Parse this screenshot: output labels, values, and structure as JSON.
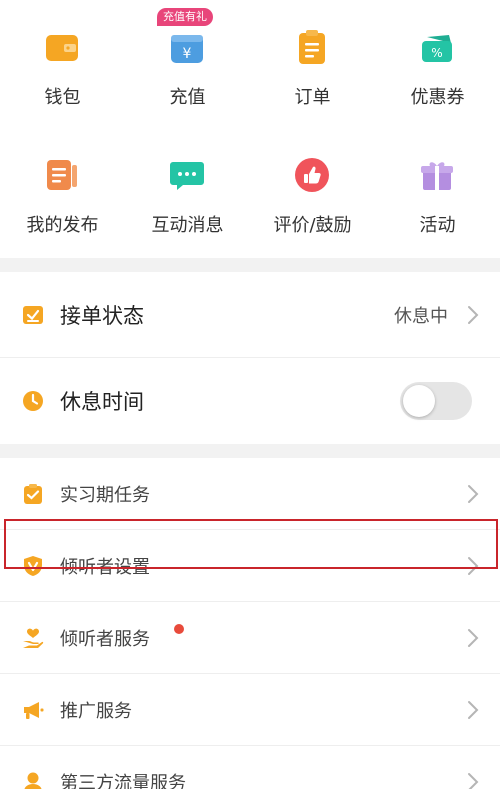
{
  "colors": {
    "wallet": "#f5a623",
    "recharge": "#4d9de0",
    "orders": "#f5a623",
    "coupons": "#24c4a5",
    "publish": "#f08a4b",
    "messages": "#24c4a5",
    "reviews": "#f0545b",
    "activity": "#b48ee0",
    "accent_orange": "#f5a623",
    "badge_pink": "#e8457a",
    "highlight_red": "#c9252b",
    "dot_red": "#e84a3b"
  },
  "grid": {
    "row1": [
      {
        "label": "钱包",
        "icon": "wallet-icon"
      },
      {
        "label": "充值",
        "icon": "recharge-icon",
        "badge": "充值有礼"
      },
      {
        "label": "订单",
        "icon": "orders-icon"
      },
      {
        "label": "优惠券",
        "icon": "coupon-icon"
      }
    ],
    "row2": [
      {
        "label": "我的发布",
        "icon": "publish-icon"
      },
      {
        "label": "互动消息",
        "icon": "message-icon"
      },
      {
        "label": "评价/鼓励",
        "icon": "thumbs-up-icon"
      },
      {
        "label": "活动",
        "icon": "gift-icon"
      }
    ]
  },
  "status": {
    "order_status": {
      "label": "接单状态",
      "value": "休息中"
    },
    "rest_time": {
      "label": "休息时间",
      "toggle_on": false
    }
  },
  "menu": {
    "items": [
      {
        "label": "实习期任务",
        "icon": "clipboard-icon"
      },
      {
        "label": "倾听者设置",
        "icon": "shield-v-icon",
        "highlighted": true
      },
      {
        "label": "倾听者服务",
        "icon": "heart-hand-icon",
        "has_dot": true
      },
      {
        "label": "推广服务",
        "icon": "megaphone-icon"
      },
      {
        "label": "第三方流量服务",
        "icon": "person-icon"
      }
    ]
  }
}
